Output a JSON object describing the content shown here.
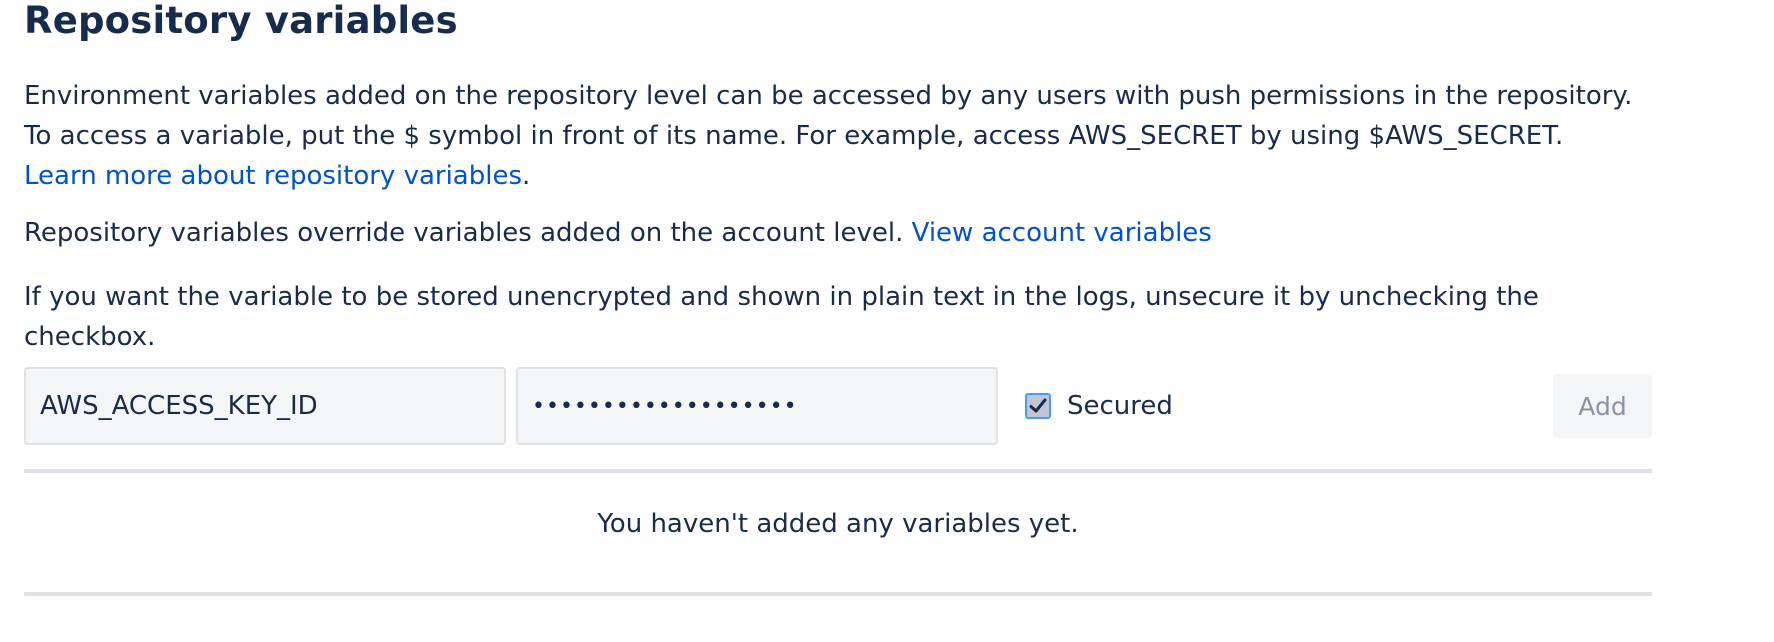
{
  "section": {
    "title": "Repository variables",
    "description": "Environment variables added on the repository level can be accessed by any users with push permissions in the repository. To access a variable, put the $ symbol in front of its name. For example, access AWS_SECRET by using $AWS_SECRET.",
    "learn_more_link": "Learn more about repository variables",
    "learn_more_suffix": ".",
    "override_text": "Repository variables override variables added on the account level.",
    "view_account_link": "View account variables",
    "unsecure_text": "If you want the variable to be stored unencrypted and shown in plain text in the logs, unsecure it by unchecking the checkbox."
  },
  "form": {
    "name_value": "AWS_ACCESS_KEY_ID",
    "secret_value": "•••••••••••••••••••",
    "secured_checked": true,
    "secured_label": "Secured",
    "add_label": "Add"
  },
  "list": {
    "empty_message": "You haven't added any variables yet."
  },
  "colors": {
    "link": "#0052CC",
    "text": "#172B4D",
    "muted_button_text": "#8993A4",
    "field_bg": "#F4F5F7",
    "divider": "#DFE1E6"
  },
  "icons": {
    "checkbox": "checkmark-icon"
  }
}
